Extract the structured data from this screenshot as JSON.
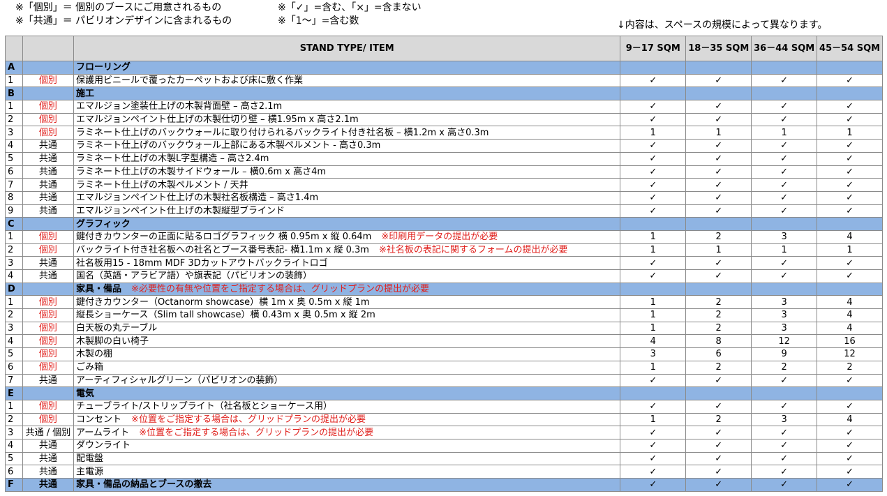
{
  "notes": {
    "n1": "※「個別」＝ 個別のブースにご用意されるもの",
    "n2": "※「共通」＝ パビリオンデザインに含まれるもの",
    "n3": "※「✓」=含む、「×」=含まない",
    "n4": "※「1～」=含む数",
    "n5": "↓内容は、スペースの規模によって異なります。"
  },
  "headers": {
    "item": "STAND TYPE/ ITEM",
    "s1": "9－17 SQM",
    "s2": "18－35 SQM",
    "s3": "36－44 SQM",
    "s4": "45－54 SQM"
  },
  "rows": [
    {
      "section": true,
      "idx": "A",
      "type": "",
      "item": "フローリング",
      "note": "",
      "v": [
        "",
        "",
        "",
        ""
      ]
    },
    {
      "idx": "1",
      "type": "個別",
      "item": "保護用ビニールで覆ったカーペットおよび床に敷く作業",
      "note": "",
      "v": [
        "✓",
        "✓",
        "✓",
        "✓"
      ]
    },
    {
      "section": true,
      "idx": "B",
      "type": "",
      "item": "施工",
      "note": "",
      "v": [
        "",
        "",
        "",
        ""
      ]
    },
    {
      "idx": "1",
      "type": "個別",
      "item": "エマルジョン塗装仕上げの木製背面壁 – 高さ2.1m",
      "note": "",
      "v": [
        "✓",
        "✓",
        "✓",
        "✓"
      ]
    },
    {
      "idx": "2",
      "type": "個別",
      "item": "エマルジョンペイント仕上げの木製仕切り壁 – 横1.95m x 高さ2.1m",
      "note": "",
      "v": [
        "✓",
        "✓",
        "✓",
        "✓"
      ]
    },
    {
      "idx": "3",
      "type": "個別",
      "item": "ラミネート仕上げのバックウォールに取り付けられるバックライト付き社名板 – 横1.2m x 高さ0.3m",
      "note": "",
      "v": [
        "1",
        "1",
        "1",
        "1"
      ]
    },
    {
      "idx": "4",
      "type": "共通",
      "item": "ラミネート仕上げのバックウォール上部にある木製ペルメント - 高さ0.3m",
      "note": "",
      "v": [
        "✓",
        "✓",
        "✓",
        "✓"
      ]
    },
    {
      "idx": "5",
      "type": "共通",
      "item": "ラミネート仕上げの木製L字型構造 – 高さ2.4m",
      "note": "",
      "v": [
        "✓",
        "✓",
        "✓",
        "✓"
      ]
    },
    {
      "idx": "6",
      "type": "共通",
      "item": "ラミネート仕上げの木製サイドウォール – 横0.6m x 高さ4m",
      "note": "",
      "v": [
        "✓",
        "✓",
        "✓",
        "✓"
      ]
    },
    {
      "idx": "7",
      "type": "共通",
      "item": "ラミネート仕上げの木製ペルメント / 天井",
      "note": "",
      "v": [
        "✓",
        "✓",
        "✓",
        "✓"
      ]
    },
    {
      "idx": "8",
      "type": "共通",
      "item": "エマルジョンペイント仕上げの木製社名板構造 – 高さ1.4m",
      "note": "",
      "v": [
        "✓",
        "✓",
        "✓",
        "✓"
      ]
    },
    {
      "idx": "9",
      "type": "共通",
      "item": "エマルジョンペイント仕上げの木製縦型ブラインド",
      "note": "",
      "v": [
        "✓",
        "✓",
        "✓",
        "✓"
      ]
    },
    {
      "section": true,
      "idx": "C",
      "type": "",
      "item": "グラフィック",
      "note": "",
      "v": [
        "",
        "",
        "",
        ""
      ]
    },
    {
      "idx": "1",
      "type": "個別",
      "item": "鍵付きカウンターの正面に貼るロゴグラフィック 横 0.95m x 縦 0.64m",
      "note": "※印刷用データの提出が必要",
      "v": [
        "1",
        "2",
        "3",
        "4"
      ]
    },
    {
      "idx": "2",
      "type": "個別",
      "item": "バックライト付き社名板への社名とブース番号表記- 横1.1m x 縦 0.3m",
      "note": "※社名板の表記に関するフォームの提出が必要",
      "v": [
        "1",
        "1",
        "1",
        "1"
      ]
    },
    {
      "idx": "3",
      "type": "共通",
      "item": "社名板用15 - 18mm MDF 3Dカットアウトバックライトロゴ",
      "note": "",
      "v": [
        "✓",
        "✓",
        "✓",
        "✓"
      ]
    },
    {
      "idx": "4",
      "type": "共通",
      "item": "国名（英語・アラビア語）や旗表記（パビリオンの装飾）",
      "note": "",
      "v": [
        "✓",
        "✓",
        "✓",
        "✓"
      ]
    },
    {
      "section": true,
      "idx": "D",
      "type": "",
      "item": "家具・備品",
      "note": "※必要性の有無や位置をご指定する場合は、グリッドプランの提出が必要",
      "v": [
        "",
        "",
        "",
        ""
      ]
    },
    {
      "idx": "1",
      "type": "個別",
      "item": "鍵付きカウンター（Octanorm showcase）横 1m x 奥 0.5m x 縦 1m",
      "note": "",
      "v": [
        "1",
        "2",
        "3",
        "4"
      ]
    },
    {
      "idx": "2",
      "type": "個別",
      "item": "縦長ショーケース（Slim tall showcase）横 0.43m x 奥 0.5m x 縦 2m",
      "note": "",
      "v": [
        "1",
        "2",
        "3",
        "4"
      ]
    },
    {
      "idx": "3",
      "type": "個別",
      "item": "白天板の丸テーブル",
      "note": "",
      "v": [
        "1",
        "2",
        "3",
        "4"
      ]
    },
    {
      "idx": "4",
      "type": "個別",
      "item": "木製脚の白い椅子",
      "note": "",
      "v": [
        "4",
        "8",
        "12",
        "16"
      ]
    },
    {
      "idx": "5",
      "type": "個別",
      "item": "木製の棚",
      "note": "",
      "v": [
        "3",
        "6",
        "9",
        "12"
      ]
    },
    {
      "idx": "6",
      "type": "個別",
      "item": "ごみ箱",
      "note": "",
      "v": [
        "1",
        "2",
        "2",
        "2"
      ]
    },
    {
      "idx": "7",
      "type": "共通",
      "item": "アーティフィシャルグリーン（パビリオンの装飾）",
      "note": "",
      "v": [
        "✓",
        "✓",
        "✓",
        "✓"
      ]
    },
    {
      "section": true,
      "idx": "E",
      "type": "",
      "item": "電気",
      "note": "",
      "v": [
        "",
        "",
        "",
        ""
      ]
    },
    {
      "idx": "1",
      "type": "個別",
      "item": "チューブライト/ストリップライト（社名板とショーケース用）",
      "note": "",
      "v": [
        "✓",
        "✓",
        "✓",
        "✓"
      ]
    },
    {
      "idx": "2",
      "type": "個別",
      "item": "コンセント",
      "note": "※位置をご指定する場合は、グリッドプランの提出が必要",
      "v": [
        "1",
        "2",
        "3",
        "4"
      ]
    },
    {
      "idx": "3",
      "type": "共通 / 個別",
      "item": "アームライト",
      "note": "※位置をご指定する場合は、グリッドプランの提出が必要",
      "v": [
        "✓",
        "✓",
        "✓",
        "✓"
      ]
    },
    {
      "idx": "4",
      "type": "共通",
      "item": "ダウンライト",
      "note": "",
      "v": [
        "✓",
        "✓",
        "✓",
        "✓"
      ]
    },
    {
      "idx": "5",
      "type": "共通",
      "item": "配電盤",
      "note": "",
      "v": [
        "✓",
        "✓",
        "✓",
        "✓"
      ]
    },
    {
      "idx": "6",
      "type": "共通",
      "item": "主電源",
      "note": "",
      "v": [
        "✓",
        "✓",
        "✓",
        "✓"
      ]
    },
    {
      "section": true,
      "idx": "F",
      "type": "共通",
      "item": "家具・備品の納品とブースの撤去",
      "note": "",
      "v": [
        "✓",
        "✓",
        "✓",
        "✓"
      ]
    }
  ],
  "colors": {
    "section_bg": "#8fb4e3",
    "header_bg": "#d9d9d9",
    "individual_text": "#e0201c",
    "note_text": "#e0201c"
  }
}
